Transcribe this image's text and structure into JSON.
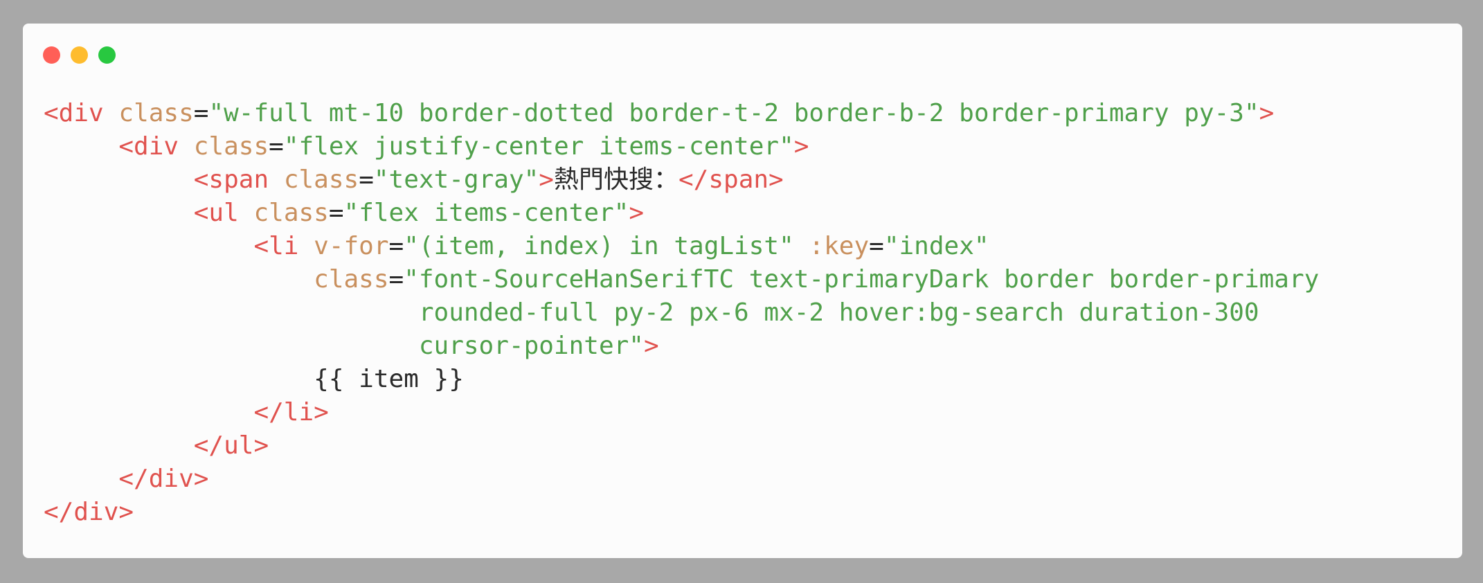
{
  "window": {
    "controls": [
      "close",
      "minimize",
      "zoom"
    ],
    "colors": {
      "close": "#ff5f57",
      "minimize": "#febc2e",
      "zoom": "#28c840"
    }
  },
  "theme": {
    "tag": "#e0524e",
    "attr": "#c9905e",
    "string": "#4fa04a",
    "text": "#2a2a2a",
    "background": "#fcfcfc",
    "frame": "#a8a8a8"
  },
  "code_lines": [
    [
      {
        "t": "<div",
        "c": "tag"
      },
      {
        "t": " ",
        "c": "plain"
      },
      {
        "t": "class",
        "c": "attr"
      },
      {
        "t": "=",
        "c": "plain"
      },
      {
        "t": "\"w-full mt-10 border-dotted border-t-2 border-b-2 border-primary py-3\"",
        "c": "str"
      },
      {
        "t": ">",
        "c": "tag"
      }
    ],
    [
      {
        "t": "     ",
        "c": "plain"
      },
      {
        "t": "<div",
        "c": "tag"
      },
      {
        "t": " ",
        "c": "plain"
      },
      {
        "t": "class",
        "c": "attr"
      },
      {
        "t": "=",
        "c": "plain"
      },
      {
        "t": "\"flex justify-center items-center\"",
        "c": "str"
      },
      {
        "t": ">",
        "c": "tag"
      }
    ],
    [
      {
        "t": "          ",
        "c": "plain"
      },
      {
        "t": "<span",
        "c": "tag"
      },
      {
        "t": " ",
        "c": "plain"
      },
      {
        "t": "class",
        "c": "attr"
      },
      {
        "t": "=",
        "c": "plain"
      },
      {
        "t": "\"text-gray\"",
        "c": "str"
      },
      {
        "t": ">",
        "c": "tag"
      },
      {
        "t": "熱門快搜：",
        "c": "cjk"
      },
      {
        "t": "</span>",
        "c": "tag"
      }
    ],
    [
      {
        "t": "          ",
        "c": "plain"
      },
      {
        "t": "<ul",
        "c": "tag"
      },
      {
        "t": " ",
        "c": "plain"
      },
      {
        "t": "class",
        "c": "attr"
      },
      {
        "t": "=",
        "c": "plain"
      },
      {
        "t": "\"flex items-center\"",
        "c": "str"
      },
      {
        "t": ">",
        "c": "tag"
      }
    ],
    [
      {
        "t": "              ",
        "c": "plain"
      },
      {
        "t": "<li",
        "c": "tag"
      },
      {
        "t": " ",
        "c": "plain"
      },
      {
        "t": "v-for",
        "c": "attr"
      },
      {
        "t": "=",
        "c": "plain"
      },
      {
        "t": "\"(item, index) in tagList\"",
        "c": "str"
      },
      {
        "t": " ",
        "c": "plain"
      },
      {
        "t": ":key",
        "c": "attr"
      },
      {
        "t": "=",
        "c": "plain"
      },
      {
        "t": "\"index\"",
        "c": "str"
      }
    ],
    [
      {
        "t": "                  ",
        "c": "plain"
      },
      {
        "t": "class",
        "c": "attr"
      },
      {
        "t": "=",
        "c": "plain"
      },
      {
        "t": "\"font-SourceHanSerifTC text-primaryDark border border-primary",
        "c": "str"
      }
    ],
    [
      {
        "t": "                         ",
        "c": "plain"
      },
      {
        "t": "rounded-full py-2 px-6 mx-2 hover:bg-search duration-300",
        "c": "str"
      }
    ],
    [
      {
        "t": "                         ",
        "c": "plain"
      },
      {
        "t": "cursor-pointer\"",
        "c": "str"
      },
      {
        "t": ">",
        "c": "tag"
      }
    ],
    [
      {
        "t": "                  ",
        "c": "plain"
      },
      {
        "t": "{{ item }}",
        "c": "plain"
      }
    ],
    [
      {
        "t": "              ",
        "c": "plain"
      },
      {
        "t": "</li>",
        "c": "tag"
      }
    ],
    [
      {
        "t": "          ",
        "c": "plain"
      },
      {
        "t": "</ul>",
        "c": "tag"
      }
    ],
    [
      {
        "t": "     ",
        "c": "plain"
      },
      {
        "t": "</div>",
        "c": "tag"
      }
    ],
    [
      {
        "t": "</div>",
        "c": "tag"
      }
    ]
  ]
}
